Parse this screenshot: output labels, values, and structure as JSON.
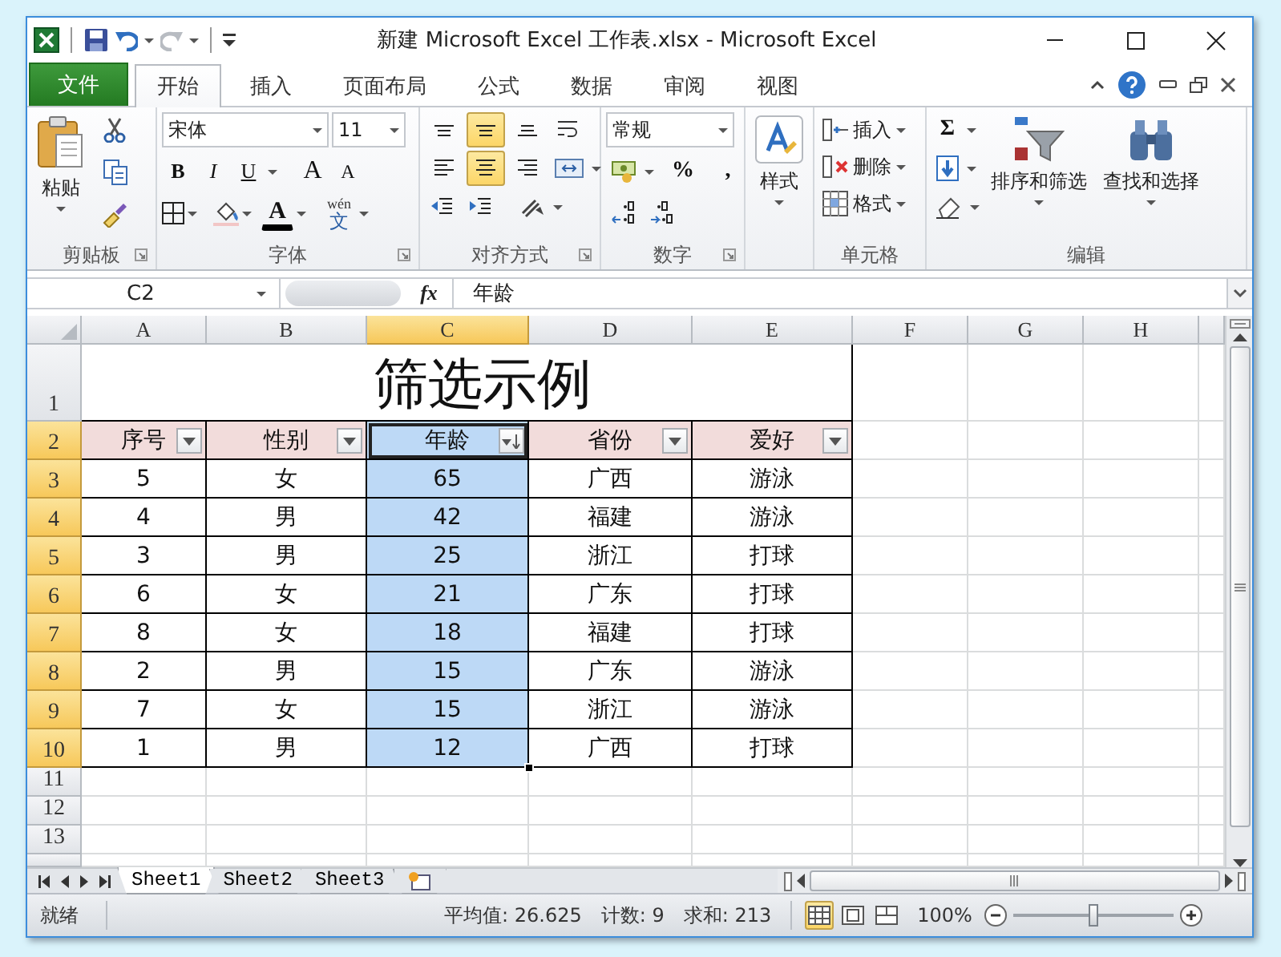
{
  "window": {
    "title": "新建 Microsoft Excel 工作表.xlsx  -  Microsoft Excel"
  },
  "ribbon": {
    "tabs": [
      {
        "label": "文件",
        "kind": "file",
        "selected": false
      },
      {
        "label": "开始",
        "kind": "tab",
        "selected": true
      },
      {
        "label": "插入",
        "kind": "tab",
        "selected": false
      },
      {
        "label": "页面布局",
        "kind": "tab",
        "selected": false
      },
      {
        "label": "公式",
        "kind": "tab",
        "selected": false
      },
      {
        "label": "数据",
        "kind": "tab",
        "selected": false
      },
      {
        "label": "审阅",
        "kind": "tab",
        "selected": false
      },
      {
        "label": "视图",
        "kind": "tab",
        "selected": false
      }
    ],
    "groups": [
      {
        "kind": "clipboard",
        "label": "剪贴板",
        "paste": "粘贴"
      },
      {
        "kind": "font",
        "label": "字体",
        "font_name": "宋体",
        "font_size": "11",
        "bold": "B",
        "italic": "I",
        "underline": "U",
        "grow": "A",
        "shrink": "A",
        "font_color": "A",
        "phonetic_top": "wén",
        "phonetic_main": "文"
      },
      {
        "kind": "alignment",
        "label": "对齐方式",
        "vertical": [
          {
            "selected": false
          },
          {
            "selected": true
          },
          {
            "selected": false
          }
        ],
        "horizontal": [
          {
            "selected": false
          },
          {
            "selected": true
          },
          {
            "selected": false
          }
        ]
      },
      {
        "kind": "number",
        "label": "数字",
        "format": "常规",
        "percent": "%",
        "comma": ","
      },
      {
        "kind": "styles",
        "label": "样式"
      },
      {
        "kind": "cells",
        "items": [
          "插入",
          "删除",
          "格式"
        ],
        "label": "单元格"
      },
      {
        "kind": "editing",
        "label": "编辑",
        "autosum": "Σ",
        "sort_filter": "排序和筛选",
        "find_select": "查找和选择"
      }
    ]
  },
  "formula_bar": {
    "name_box": "C2",
    "function_label": "fx",
    "content": "年龄"
  },
  "sheet": {
    "column_headers": [
      {
        "label": "A",
        "selected": false
      },
      {
        "label": "B",
        "selected": false
      },
      {
        "label": "C",
        "selected": true
      },
      {
        "label": "D",
        "selected": false
      },
      {
        "label": "E",
        "selected": false
      },
      {
        "label": "F",
        "selected": false
      },
      {
        "label": "G",
        "selected": false
      },
      {
        "label": "H",
        "selected": false
      }
    ],
    "row_headers": [
      {
        "label": "1",
        "selected": false
      },
      {
        "label": "2",
        "selected": true
      },
      {
        "label": "3",
        "selected": true
      },
      {
        "label": "4",
        "selected": true
      },
      {
        "label": "5",
        "selected": true
      },
      {
        "label": "6",
        "selected": true
      },
      {
        "label": "7",
        "selected": true
      },
      {
        "label": "8",
        "selected": true
      },
      {
        "label": "9",
        "selected": true
      },
      {
        "label": "10",
        "selected": true
      },
      {
        "label": "11",
        "selected": false
      },
      {
        "label": "12",
        "selected": false
      },
      {
        "label": "13",
        "selected": false
      }
    ],
    "title": "筛选示例",
    "table": {
      "columns": [
        {
          "header": "序号",
          "sorted": false,
          "selected": false
        },
        {
          "header": "性别",
          "sorted": false,
          "selected": false
        },
        {
          "header": "年龄",
          "sorted": true,
          "selected": true
        },
        {
          "header": "省份",
          "sorted": false,
          "selected": false
        },
        {
          "header": "爱好",
          "sorted": false,
          "selected": false
        }
      ],
      "rows": [
        [
          "5",
          "女",
          "65",
          "广西",
          "游泳"
        ],
        [
          "4",
          "男",
          "42",
          "福建",
          "游泳"
        ],
        [
          "3",
          "男",
          "25",
          "浙江",
          "打球"
        ],
        [
          "6",
          "女",
          "21",
          "广东",
          "打球"
        ],
        [
          "8",
          "女",
          "18",
          "福建",
          "打球"
        ],
        [
          "2",
          "男",
          "15",
          "广东",
          "游泳"
        ],
        [
          "7",
          "女",
          "15",
          "浙江",
          "游泳"
        ],
        [
          "1",
          "男",
          "12",
          "广西",
          "打球"
        ]
      ]
    }
  },
  "sheet_tabs": [
    {
      "label": "Sheet1",
      "selected": true
    },
    {
      "label": "Sheet2",
      "selected": false
    },
    {
      "label": "Sheet3",
      "selected": false
    }
  ],
  "status_bar": {
    "mode": "就绪",
    "average": "平均值: 26.625",
    "count": "计数: 9",
    "sum": "求和: 213",
    "views": [
      {
        "kind": "normal",
        "selected": true
      },
      {
        "kind": "page_layout",
        "selected": false
      },
      {
        "kind": "page_break",
        "selected": false
      }
    ],
    "zoom": {
      "label": "100%",
      "level": 0.5
    }
  }
}
